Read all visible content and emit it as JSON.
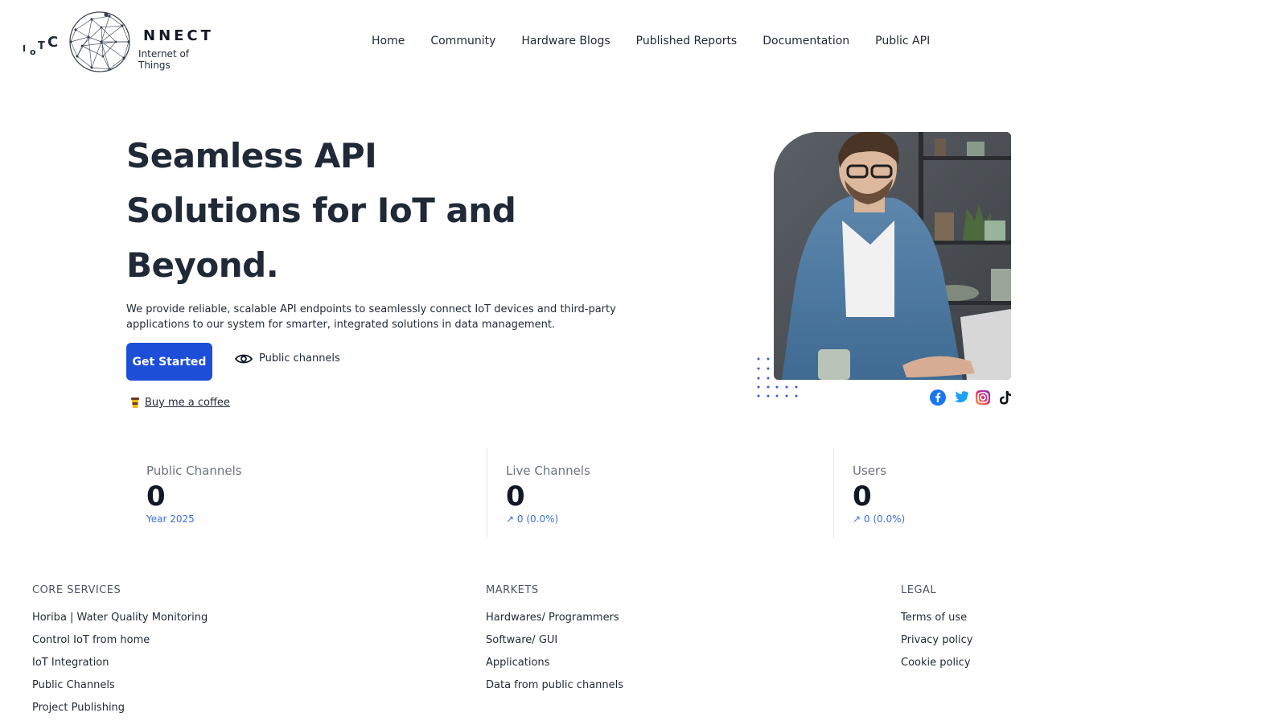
{
  "header": {
    "logo_prefix": [
      "I",
      "o",
      "T",
      "C"
    ],
    "brand": "NNECT",
    "tagline": "Internet of Things",
    "nav": [
      "Home",
      "Community",
      "Hardware Blogs",
      "Published Reports",
      "Documentation",
      "Public API"
    ]
  },
  "hero": {
    "title_lines": [
      "Seamless API",
      "Solutions for IoT and",
      "Beyond."
    ],
    "description": "We provide reliable, scalable API endpoints to seamlessly connect IoT devices and third-party applications to our system for smarter, integrated solutions in data management.",
    "primary_button": "Get Started",
    "secondary_button": "Public channels",
    "coffee_link": "Buy me a coffee",
    "social_icons": [
      "facebook-icon",
      "twitter-icon",
      "instagram-icon",
      "tiktok-icon"
    ]
  },
  "stats": [
    {
      "label": "Public Channels",
      "value": "0",
      "sub": "Year 2025"
    },
    {
      "label": "Live Channels",
      "value": "0",
      "sub": "↗ 0 (0.0%)"
    },
    {
      "label": "Users",
      "value": "0",
      "sub": "↗ 0 (0.0%)"
    }
  ],
  "footer": {
    "columns": [
      {
        "title": "CORE SERVICES",
        "links": [
          "Horiba | Water Quality Monitoring",
          "Control IoT from home",
          "IoT Integration",
          "Public Channels",
          "Project Publishing"
        ]
      },
      {
        "title": "MARKETS",
        "links": [
          "Hardwares/ Programmers",
          "Software/ GUI",
          "Applications",
          "Data from public channels"
        ]
      },
      {
        "title": "LEGAL",
        "links": [
          "Terms of use",
          "Privacy policy",
          "Cookie policy"
        ]
      }
    ]
  },
  "colors": {
    "accent": "#1d4ed8",
    "stat_sub": "#3b6fd6"
  }
}
